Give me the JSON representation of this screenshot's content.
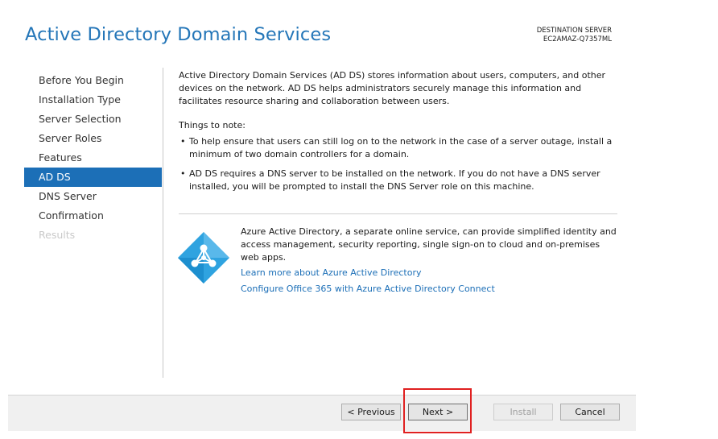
{
  "header": {
    "title": "Active Directory Domain Services",
    "destination_label": "DESTINATION SERVER",
    "destination_server": "EC2AMAZ-Q7357ML"
  },
  "nav": {
    "items": [
      {
        "label": "Before You Begin",
        "state": "normal"
      },
      {
        "label": "Installation Type",
        "state": "normal"
      },
      {
        "label": "Server Selection",
        "state": "normal"
      },
      {
        "label": "Server Roles",
        "state": "normal"
      },
      {
        "label": "Features",
        "state": "normal"
      },
      {
        "label": "AD DS",
        "state": "selected"
      },
      {
        "label": "DNS Server",
        "state": "normal"
      },
      {
        "label": "Confirmation",
        "state": "normal"
      },
      {
        "label": "Results",
        "state": "disabled"
      }
    ]
  },
  "content": {
    "intro": "Active Directory Domain Services (AD DS) stores information about users, computers, and other devices on the network.  AD DS helps administrators securely manage this information and facilitates resource sharing and collaboration between users.",
    "notes_heading": "Things to note:",
    "notes": [
      "To help ensure that users can still log on to the network in the case of a server outage, install a minimum of two domain controllers for a domain.",
      "AD DS requires a DNS server to be installed on the network.  If you do not have a DNS server installed, you will be prompted to install the DNS Server role on this machine."
    ]
  },
  "azure": {
    "description": "Azure Active Directory, a separate online service, can provide simplified identity and access management, security reporting, single sign-on to cloud and on-premises web apps.",
    "link_learn": "Learn more about Azure Active Directory",
    "link_configure": "Configure Office 365 with Azure Active Directory Connect",
    "icon": "azure-ad-diamond-icon"
  },
  "footer": {
    "previous_label": "< Previous",
    "next_label": "Next >",
    "install_label": "Install",
    "cancel_label": "Cancel"
  },
  "colors": {
    "accent": "#1c6fb7",
    "title": "#2476b8",
    "highlight": "#e02020",
    "azure": "#2fa3e0"
  }
}
